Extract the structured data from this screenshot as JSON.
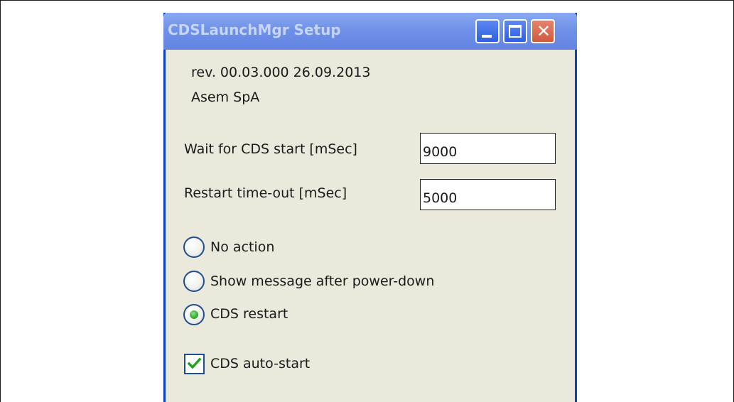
{
  "window": {
    "title": "CDSLaunchMgr Setup",
    "controls": {
      "minimize_icon": "minimize-icon",
      "maximize_icon": "maximize-icon",
      "close_icon": "close-icon",
      "close_glyph": "✕"
    }
  },
  "info": {
    "revision": "rev. 00.03.000 26.09.2013",
    "company": "Asem SpA"
  },
  "settings": {
    "wait_label": "Wait for CDS start [mSec]",
    "wait_value": "9000",
    "restart_label": "Restart time-out [mSec]",
    "restart_value": "5000"
  },
  "options": [
    {
      "label": "No action",
      "selected": false
    },
    {
      "label": "Show message after power-down",
      "selected": false
    },
    {
      "label": "CDS restart",
      "selected": true
    }
  ],
  "autostart": {
    "label": "CDS auto-start",
    "checked": true
  },
  "colors": {
    "window_bg": "#ebe8dc",
    "titlebar": "#6f91e8",
    "border": "#0842c9",
    "close_button": "#d05a3f",
    "check_green": "#21a121"
  }
}
